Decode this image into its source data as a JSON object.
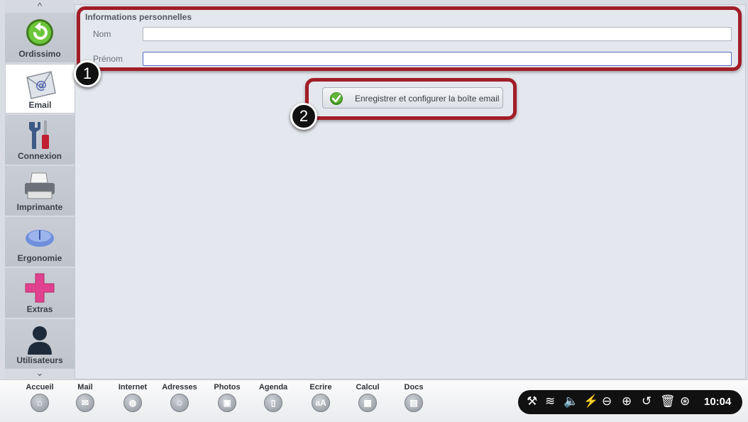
{
  "sidebar": {
    "items": [
      {
        "label": "Ordissimo",
        "icon": "back-arrow-icon"
      },
      {
        "label": "Email",
        "icon": "email-envelope-icon"
      },
      {
        "label": "Connexion",
        "icon": "tools-icon"
      },
      {
        "label": "Imprimante",
        "icon": "printer-icon"
      },
      {
        "label": "Ergonomie",
        "icon": "mouse-icon"
      },
      {
        "label": "Extras",
        "icon": "plus-icon"
      },
      {
        "label": "Utilisateurs",
        "icon": "user-icon"
      }
    ],
    "scroll_up": "^",
    "scroll_down": "⌄"
  },
  "form": {
    "section_title": "Informations personnelles",
    "nom_label": "Nom",
    "nom_value": "",
    "prenom_label": "Prénom",
    "prenom_value": "",
    "save_label": "Enregistrer et configurer la boîte email"
  },
  "callouts": {
    "one": "1",
    "two": "2",
    "color": "#a11d27"
  },
  "taskbar": {
    "items": [
      {
        "label": "Accueil",
        "glyph": "⌂"
      },
      {
        "label": "Mail",
        "glyph": "✉"
      },
      {
        "label": "Internet",
        "glyph": "◍"
      },
      {
        "label": "Adresses",
        "glyph": "☺"
      },
      {
        "label": "Photos",
        "glyph": "▣"
      },
      {
        "label": "Agenda",
        "glyph": "▯"
      },
      {
        "label": "Ecrire",
        "glyph": "aA"
      },
      {
        "label": "Calcul",
        "glyph": "▦"
      },
      {
        "label": "Docs",
        "glyph": "▤"
      }
    ],
    "tray": {
      "tools": "⚒",
      "wifi": "≋",
      "volume": "🔈",
      "battery": "⚡",
      "minus": "⊖",
      "plus": "⊕",
      "back": "↺",
      "trash": "🗑",
      "help": "⊛",
      "time": "10:04"
    }
  }
}
